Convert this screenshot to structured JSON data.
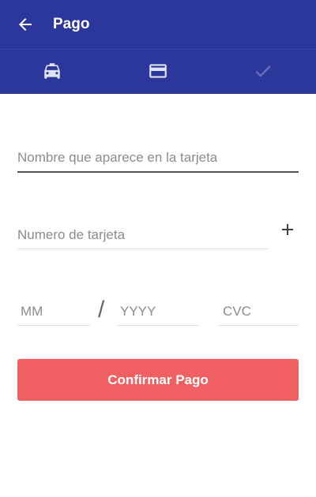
{
  "appbar": {
    "title": "Pago",
    "back_icon": "arrow-left-icon",
    "background": "#2b379b"
  },
  "steps": [
    {
      "icon": "taxi-icon",
      "state": "active"
    },
    {
      "icon": "credit-card-icon",
      "state": "active"
    },
    {
      "icon": "check-icon",
      "state": "inactive"
    }
  ],
  "form": {
    "card_name_placeholder": "Nombre que aparece en la tarjeta",
    "card_number_placeholder": "Numero de tarjeta",
    "add_icon": "plus-icon",
    "month_placeholder": "MM",
    "separator": "/",
    "year_placeholder": "YYYY",
    "cvc_placeholder": "CVC"
  },
  "confirm_button": {
    "label": "Confirmar Pago",
    "color": "#f06063"
  }
}
